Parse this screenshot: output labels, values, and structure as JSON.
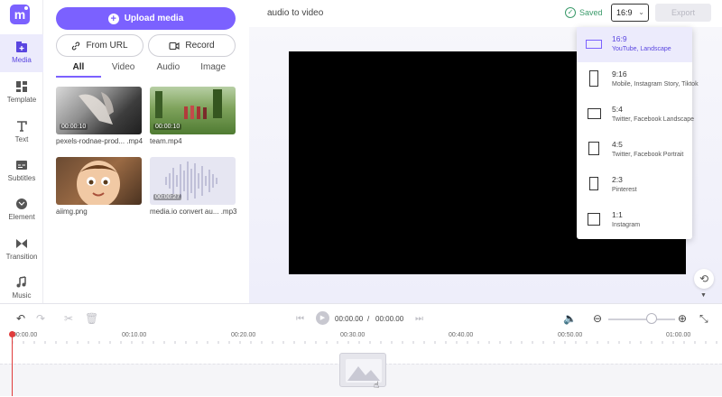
{
  "app": {
    "logo_letter": "m",
    "accent": "#7b61ff"
  },
  "nav": [
    {
      "label": "Media",
      "icon": "media-icon",
      "active": true
    },
    {
      "label": "Template",
      "icon": "template-icon"
    },
    {
      "label": "Text",
      "icon": "text-icon"
    },
    {
      "label": "Subtitles",
      "icon": "subtitles-icon"
    },
    {
      "label": "Element",
      "icon": "element-icon"
    },
    {
      "label": "Transition",
      "icon": "transition-icon"
    },
    {
      "label": "Music",
      "icon": "music-icon"
    }
  ],
  "panel": {
    "upload_label": "Upload media",
    "from_url_label": "From URL",
    "record_label": "Record",
    "tabs": [
      "All",
      "Video",
      "Audio",
      "Image"
    ],
    "media": [
      {
        "name": "pexels-rodnae-prod... .mp4",
        "duration": "00:00:10"
      },
      {
        "name": "team.mp4",
        "duration": "00:00:10"
      },
      {
        "name": "aiimg.png",
        "duration": ""
      },
      {
        "name": "media.io convert au... .mp3",
        "duration": "00:00:27"
      }
    ]
  },
  "topbar": {
    "project_title": "audio to video",
    "saved_label": "Saved",
    "ratio_value": "16:9",
    "export_label": "Export"
  },
  "ratio_menu": [
    {
      "ratio": "16:9",
      "desc": "YouTube, Landscape",
      "selected": true
    },
    {
      "ratio": "9:16",
      "desc": "Mobile, Instagram Story, Tiktok"
    },
    {
      "ratio": "5:4",
      "desc": "Twitter, Facebook Landscape"
    },
    {
      "ratio": "4:5",
      "desc": "Twitter, Facebook Portrait"
    },
    {
      "ratio": "2:3",
      "desc": "Pinterest"
    },
    {
      "ratio": "1:1",
      "desc": "Instagram"
    }
  ],
  "timeline": {
    "current_time": "00:00.00",
    "separator": "/",
    "total_time": "00:00.00",
    "ticks": [
      "00:00.00",
      "00:10.00",
      "00:20.00",
      "00:30.00",
      "00:40.00",
      "00:50.00",
      "01:00.00"
    ]
  }
}
